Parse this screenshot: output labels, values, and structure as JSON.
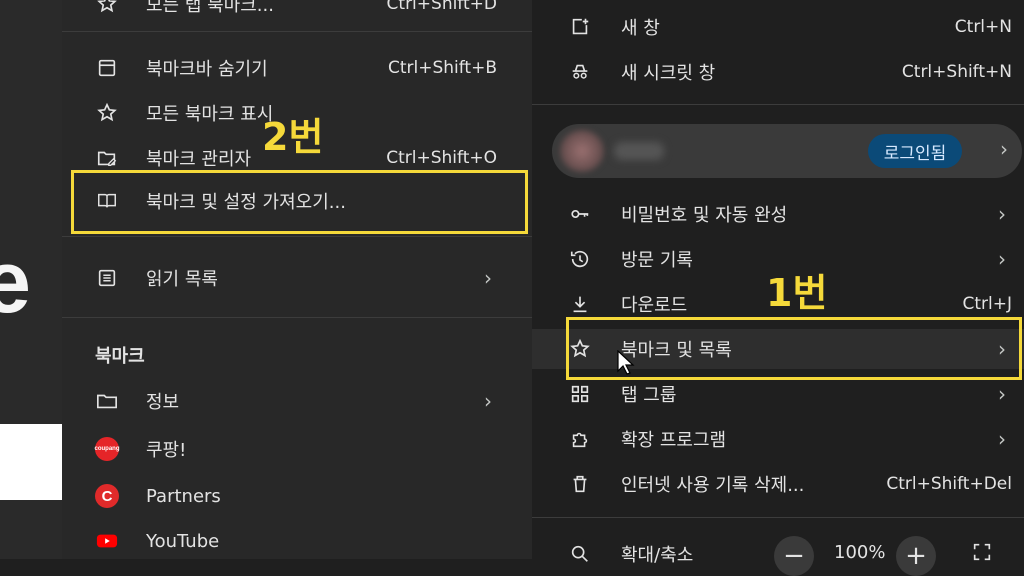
{
  "submenu": {
    "top_partial": {
      "label": "모든 탭 북마크...",
      "shortcut": "Ctrl+Shift+D"
    },
    "items": [
      {
        "label": "북마크바 숨기기",
        "shortcut": "Ctrl+Shift+B",
        "icon": "bookmark-bar-icon"
      },
      {
        "label": "모든 북마크 표시",
        "shortcut": "",
        "icon": "star-icon"
      },
      {
        "label": "북마크 관리자",
        "shortcut": "Ctrl+Shift+O",
        "icon": "folder-edit-icon"
      },
      {
        "label": "북마크 및 설정 가져오기...",
        "shortcut": "",
        "icon": "book-icon"
      },
      {
        "label": "읽기 목록",
        "shortcut": "",
        "icon": "reading-list-icon"
      }
    ],
    "section_title": "북마크",
    "bookmarks": [
      {
        "label": "정보",
        "icon": "folder-icon"
      },
      {
        "label": "쿠팡!",
        "icon": "coupang-favicon"
      },
      {
        "label": "Partners",
        "icon": "partners-favicon"
      },
      {
        "label": "YouTube",
        "icon": "youtube-favicon"
      }
    ]
  },
  "mainmenu": {
    "new_window": {
      "label": "새 창",
      "shortcut": "Ctrl+N"
    },
    "incognito": {
      "label": "새 시크릿 창",
      "shortcut": "Ctrl+Shift+N"
    },
    "profile": {
      "badge": "로그인됨"
    },
    "items": [
      {
        "label": "비밀번호 및 자동 완성",
        "shortcut": ""
      },
      {
        "label": "방문 기록",
        "shortcut": ""
      },
      {
        "label": "다운로드",
        "shortcut": "Ctrl+J"
      },
      {
        "label": "북마크 및 목록",
        "shortcut": ""
      },
      {
        "label": "탭 그룹",
        "shortcut": ""
      },
      {
        "label": "확장 프로그램",
        "shortcut": ""
      },
      {
        "label": "인터넷 사용 기록 삭제...",
        "shortcut": "Ctrl+Shift+Del"
      }
    ],
    "zoom": {
      "label": "확대/축소",
      "minus": "−",
      "value": "100%",
      "plus": "+"
    }
  },
  "annotations": {
    "step1": "1번",
    "step2": "2번"
  },
  "bg": {
    "letter": "e"
  },
  "colors": {
    "highlight": "#f5d93a",
    "badge": "#0b4a78",
    "youtube": "#ff0000",
    "partners": "#e02a2a",
    "coupang": "#e52528"
  }
}
